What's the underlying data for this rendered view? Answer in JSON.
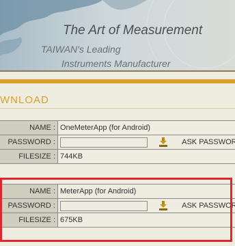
{
  "banner": {
    "tagline": "The Art of Measurement",
    "subtitle_line1": "TAIWAN's Leading",
    "subtitle_line2": "Instruments Manufacturer"
  },
  "section_title": "WNLOAD",
  "downloads": [
    {
      "name_label": "NAME :",
      "name_value": "OneMeterApp (for Android)",
      "password_label": "PASSWORD :",
      "password_value": "",
      "ask_password": "ASK PASSWORD",
      "filesize_label": "FILESIZE :",
      "filesize_value": "744KB"
    },
    {
      "name_label": "NAME :",
      "name_value": "MeterApp (for Android)",
      "password_label": "PASSWORD :",
      "password_value": "",
      "ask_password": "ASK PASSWORD",
      "filesize_label": "FILESIZE :",
      "filesize_value": "675KB"
    }
  ],
  "colors": {
    "accent_gold": "#d9a12b",
    "highlight_red": "#e0262e",
    "label_bg": "#cfcebf",
    "page_bg": "#efece0"
  },
  "icons": {
    "download_icon": "download-icon",
    "world_map": "world-map-graphic"
  }
}
